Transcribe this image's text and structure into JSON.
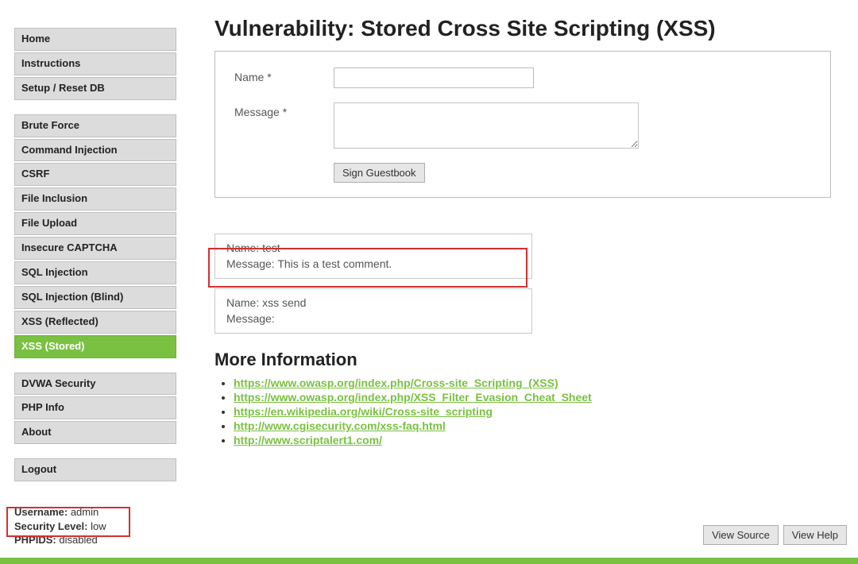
{
  "sidebar": {
    "groups": [
      {
        "items": [
          "Home",
          "Instructions",
          "Setup / Reset DB"
        ]
      },
      {
        "items": [
          "Brute Force",
          "Command Injection",
          "CSRF",
          "File Inclusion",
          "File Upload",
          "Insecure CAPTCHA",
          "SQL Injection",
          "SQL Injection (Blind)",
          "XSS (Reflected)",
          "XSS (Stored)"
        ],
        "selected_index": 9
      },
      {
        "items": [
          "DVWA Security",
          "PHP Info",
          "About"
        ]
      },
      {
        "items": [
          "Logout"
        ]
      }
    ],
    "status": {
      "username_label": "Username:",
      "username_value": "admin",
      "security_label": "Security Level:",
      "security_value": "low",
      "phpids_label": "PHPIDS:",
      "phpids_value": "disabled"
    }
  },
  "main": {
    "title": "Vulnerability: Stored Cross Site Scripting (XSS)",
    "form": {
      "name_label": "Name *",
      "message_label": "Message *",
      "submit_label": "Sign Guestbook",
      "name_value": "",
      "message_value": ""
    },
    "entries": [
      {
        "name_label": "Name:",
        "name": "test",
        "message_label": "Message:",
        "message": "This is a test comment."
      },
      {
        "name_label": "Name:",
        "name": "xss send",
        "message_label": "Message:",
        "message": ""
      }
    ],
    "more_info_heading": "More Information",
    "links": [
      "https://www.owasp.org/index.php/Cross-site_Scripting_(XSS)",
      "https://www.owasp.org/index.php/XSS_Filter_Evasion_Cheat_Sheet",
      "https://en.wikipedia.org/wiki/Cross-site_scripting",
      "http://www.cgisecurity.com/xss-faq.html",
      "http://www.scriptalert1.com/"
    ],
    "footer": {
      "view_source": "View Source",
      "view_help": "View Help"
    }
  }
}
